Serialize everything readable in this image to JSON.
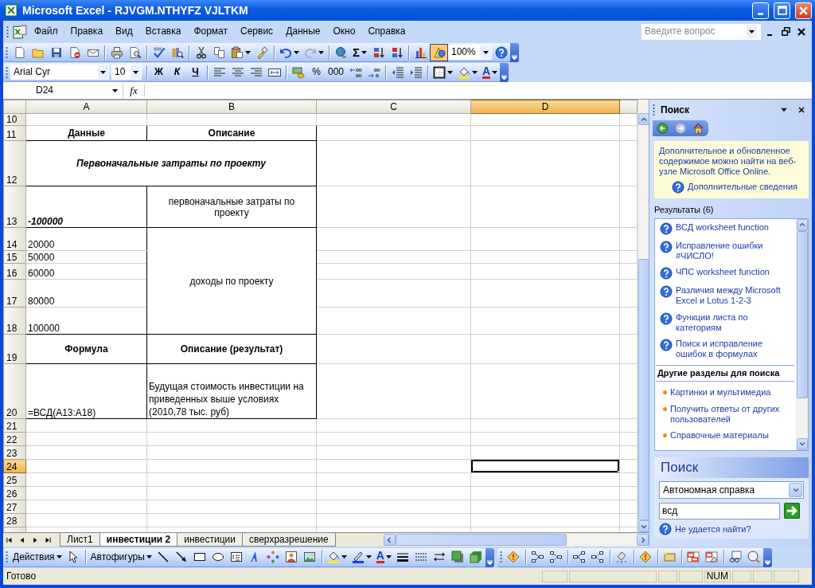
{
  "window": {
    "title": "Microsoft Excel - RJVGM.NTHYFZ VJLTKM"
  },
  "menu": [
    "Файл",
    "Правка",
    "Вид",
    "Вставка",
    "Формат",
    "Сервис",
    "Данные",
    "Окно",
    "Справка"
  ],
  "question_box": {
    "placeholder": "Введите вопрос"
  },
  "standard_toolbar": {
    "sum": "Σ",
    "drawing_pressed": true,
    "zoom": "100%"
  },
  "formatting_toolbar": {
    "font": "Arial Cyr",
    "size": "10",
    "bold": "Ж",
    "italic": "К",
    "underline": "Ч",
    "percent": "%",
    "thousands": "000",
    "font_color": "A"
  },
  "formula_bar": {
    "name_box": "D24",
    "fx": "fx"
  },
  "sheet": {
    "columns": [
      {
        "label": "A",
        "selected": false
      },
      {
        "label": "B",
        "selected": false
      },
      {
        "label": "C",
        "selected": false
      },
      {
        "label": "D",
        "selected": true
      }
    ],
    "rows": [
      {
        "number": "10",
        "selected": false,
        "kind": "blank"
      },
      {
        "number": "11",
        "selected": false,
        "kind": "header",
        "a": "Данные",
        "b": "Описание"
      },
      {
        "number": "12",
        "selected": false,
        "kind": "title",
        "a": "Первоначальные затраты по проекту"
      },
      {
        "number": "13",
        "selected": false,
        "kind": "cost",
        "a": "-100000",
        "b": "первоначальные затраты по проекту"
      },
      {
        "number": "14",
        "selected": false,
        "kind": "income",
        "a": "20000",
        "b": "доходы по проекту"
      },
      {
        "number": "15",
        "selected": false,
        "kind": "income-cont",
        "a": "50000"
      },
      {
        "number": "16",
        "selected": false,
        "kind": "income-cont",
        "a": "60000"
      },
      {
        "number": "17",
        "selected": false,
        "kind": "income-cont",
        "a": "80000"
      },
      {
        "number": "18",
        "selected": false,
        "kind": "income-cont",
        "a": "100000"
      },
      {
        "number": "19",
        "selected": false,
        "kind": "header",
        "a": "Формула",
        "b": "Описание (результат)"
      },
      {
        "number": "20",
        "selected": false,
        "kind": "result",
        "a": "=ВСД(A13:A18)",
        "b": "Будущая стоимость инвестиции на приведенных выше условиях (2010,78 тыс. руб)"
      },
      {
        "number": "21",
        "selected": false,
        "kind": "blank"
      },
      {
        "number": "22",
        "selected": false,
        "kind": "blank"
      },
      {
        "number": "23",
        "selected": false,
        "kind": "blank"
      },
      {
        "number": "24",
        "selected": true,
        "kind": "blank"
      },
      {
        "number": "25",
        "selected": false,
        "kind": "blank"
      },
      {
        "number": "26",
        "selected": false,
        "kind": "blank"
      },
      {
        "number": "27",
        "selected": false,
        "kind": "blank"
      },
      {
        "number": "28",
        "selected": false,
        "kind": "blank"
      }
    ]
  },
  "sheet_tabs": [
    {
      "label": "Лист1",
      "selected": false
    },
    {
      "label": "инвестиции 2",
      "selected": true
    },
    {
      "label": "инвестиции",
      "selected": false
    },
    {
      "label": "сверхразрешение",
      "selected": false
    }
  ],
  "task_pane": {
    "title": "Поиск",
    "info": "Дополнительное и обновленное содержимое можно найти на веб-узле Microsoft Office Online.",
    "info_link": "Дополнительные сведения",
    "results_label": "Результаты (6)",
    "results": [
      "ВСД worksheet function",
      "Исправление ошибки #ЧИСЛО!",
      "ЧПС worksheet function",
      "Различия между Microsoft Excel и Lotus 1-2-3",
      "Функции листа по категориям",
      "Поиск и исправление ошибок в формулах"
    ],
    "other_heading": "Другие разделы для поиска",
    "other_links": [
      "Картинки и мультимедиа",
      "Получить ответы от других пользователей",
      "Справочные материалы"
    ],
    "search": {
      "heading": "Поиск",
      "scope": "Автономная справка",
      "query": "всд",
      "help_link": "Не удается найти?"
    }
  },
  "drawing_toolbar": {
    "actions": "Действия",
    "autoshapes": "Автофигуры",
    "font_color": "A"
  },
  "status_bar": {
    "text": "Готово",
    "num": "NUM"
  }
}
